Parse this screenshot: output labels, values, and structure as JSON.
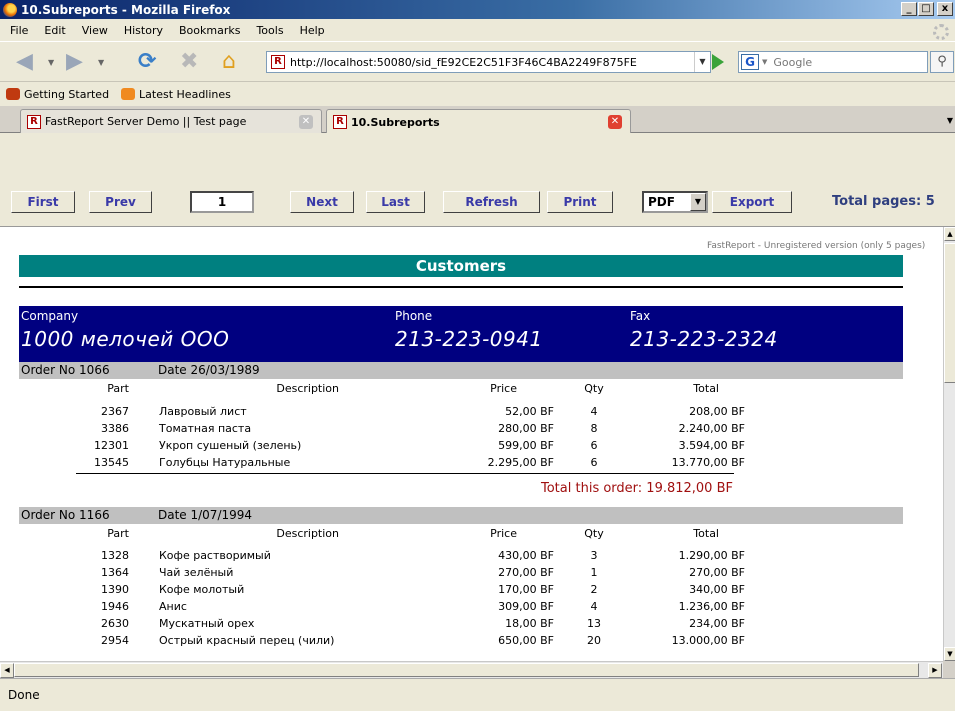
{
  "window": {
    "title": "10.Subreports - Mozilla Firefox",
    "min": "_",
    "max": "□",
    "close": "x"
  },
  "menu": [
    "File",
    "Edit",
    "View",
    "History",
    "Bookmarks",
    "Tools",
    "Help"
  ],
  "nav": {
    "url": "http://localhost:50080/sid_fE92CE2C51F3F46C4BA2249F875FE",
    "search_placeholder": "Google"
  },
  "bookmarks": [
    "Getting Started",
    "Latest Headlines"
  ],
  "tabs": [
    {
      "label": "FastReport Server Demo || Test page"
    },
    {
      "label": "10.Subreports"
    }
  ],
  "report_toolbar": {
    "first": "First",
    "prev": "Prev",
    "page": "1",
    "next": "Next",
    "last": "Last",
    "refresh": "Refresh",
    "print": "Print",
    "format": "PDF",
    "export": "Export",
    "total_pages": "Total pages: 5"
  },
  "report": {
    "watermark": "FastReport - Unregistered version (only 5 pages)",
    "title": "Customers",
    "customer": {
      "company_label": "Company",
      "company": "1000 мелочей ООО",
      "phone_label": "Phone",
      "phone": "213-223-0941",
      "fax_label": "Fax",
      "fax": "213-223-2324"
    },
    "columns": {
      "part": "Part",
      "description": "Description",
      "price": "Price",
      "qty": "Qty",
      "total": "Total"
    },
    "orders": [
      {
        "order_no": "Order No 1066",
        "date": "Date 26/03/1989",
        "items": [
          {
            "part": "2367",
            "description": "Лавровый лист",
            "price": "52,00 BF",
            "qty": "4",
            "total": "208,00 BF"
          },
          {
            "part": "3386",
            "description": "Томатная паста",
            "price": "280,00 BF",
            "qty": "8",
            "total": "2.240,00 BF"
          },
          {
            "part": "12301",
            "description": "Укроп сушеный (зелень)",
            "price": "599,00 BF",
            "qty": "6",
            "total": "3.594,00 BF"
          },
          {
            "part": "13545",
            "description": "Голубцы Натуральные",
            "price": "2.295,00 BF",
            "qty": "6",
            "total": "13.770,00 BF"
          }
        ],
        "total": "Total this order: 19.812,00 BF"
      },
      {
        "order_no": "Order No 1166",
        "date": "Date 1/07/1994",
        "items": [
          {
            "part": "1328",
            "description": "Кофе растворимый",
            "price": "430,00 BF",
            "qty": "3",
            "total": "1.290,00 BF"
          },
          {
            "part": "1364",
            "description": "Чай зелёный",
            "price": "270,00 BF",
            "qty": "1",
            "total": "270,00 BF"
          },
          {
            "part": "1390",
            "description": "Кофе молотый",
            "price": "170,00 BF",
            "qty": "2",
            "total": "340,00 BF"
          },
          {
            "part": "1946",
            "description": "Анис",
            "price": "309,00 BF",
            "qty": "4",
            "total": "1.236,00 BF"
          },
          {
            "part": "2630",
            "description": "Мускатный орех",
            "price": "18,00 BF",
            "qty": "13",
            "total": "234,00 BF"
          },
          {
            "part": "2954",
            "description": "Острый красный перец (чили)",
            "price": "650,00 BF",
            "qty": "20",
            "total": "13.000,00 BF"
          }
        ]
      }
    ]
  },
  "status": "Done"
}
